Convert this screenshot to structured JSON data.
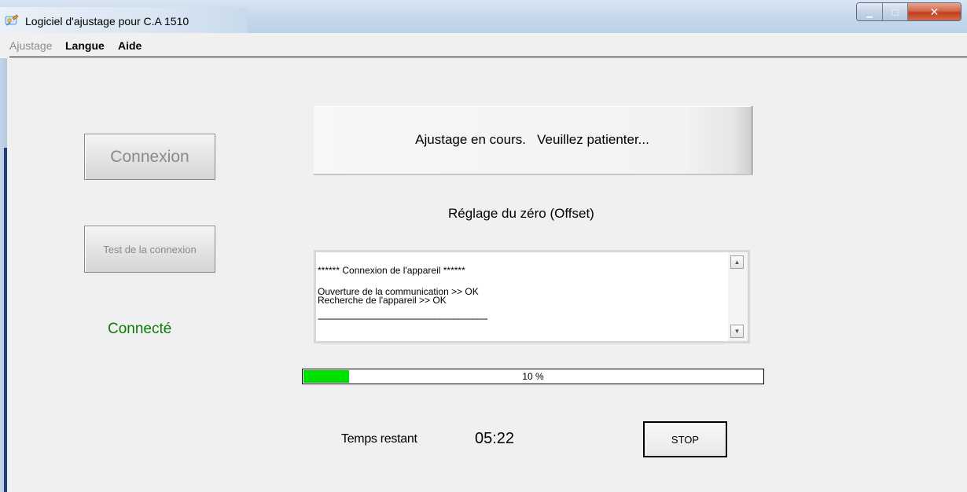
{
  "window": {
    "title": "Logiciel d'ajustage pour C.A 1510",
    "minimize_glyph": "▁",
    "maximize_glyph": "□",
    "close_glyph": "✕"
  },
  "menu": {
    "items": [
      {
        "label": "Ajustage",
        "enabled": false
      },
      {
        "label": "Langue",
        "enabled": true
      },
      {
        "label": "Aide",
        "enabled": true
      }
    ]
  },
  "left_panel": {
    "connect_label": "Connexion",
    "test_label": "Test de la connexion",
    "status_text": "Connecté"
  },
  "banner": {
    "text": "Ajustage en cours.   Veuillez patienter..."
  },
  "step": {
    "label": "Réglage du zéro (Offset)"
  },
  "log": {
    "lines": [
      "****** Connexion de l'appareil ******",
      "Ouverture de la communication >> OK",
      "Recherche de l'appareil >> OK",
      "------------------------------------------------------------------------"
    ],
    "scroll_up_glyph": "▲",
    "scroll_down_glyph": "▼"
  },
  "progress": {
    "percent": 10,
    "label": "10 %",
    "fill_color": "#00e000"
  },
  "timer": {
    "label": "Temps restant",
    "value": "05:22"
  },
  "actions": {
    "stop_label": "STOP"
  },
  "colors": {
    "status_connected": "#0a7a0a",
    "disabled_text": "#8a8a8a"
  }
}
